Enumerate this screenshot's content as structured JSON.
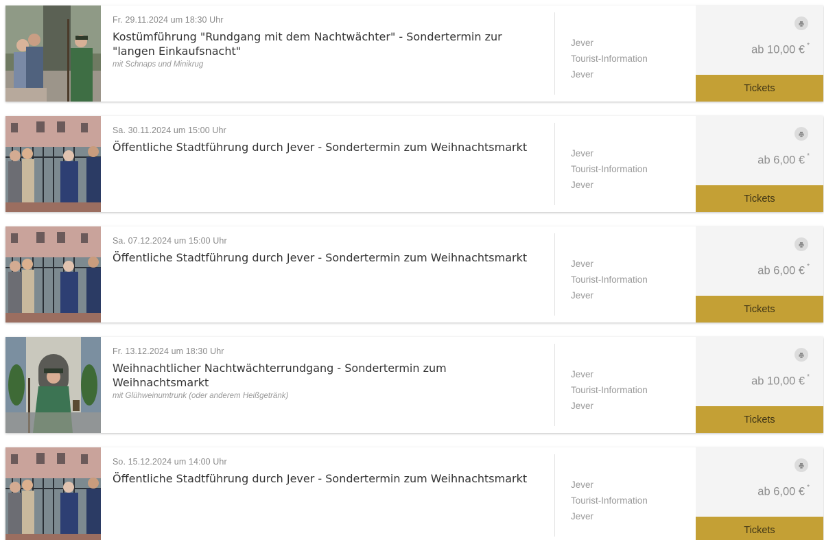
{
  "colors": {
    "tickets_button": "#c4a035",
    "price_panel": "#f4f4f4",
    "date_text": "#8a8a8a",
    "location_text": "#9a9a9a"
  },
  "events": [
    {
      "date": "Fr. 29.11.2024 um 18:30 Uhr",
      "title": "Kostümführung \"Rundgang mit dem Nachtwächter\" - Sondertermin zur \"langen Einkaufsnacht\"",
      "subtitle": "mit Schnaps und Minikrug",
      "location": [
        "Jever",
        "Tourist-Information",
        "Jever"
      ],
      "price": "ab 10,00 €",
      "price_mark": "*",
      "tickets_label": "Tickets",
      "print_icon": "print-icon",
      "image": "night-watchman-group-photo"
    },
    {
      "date": "Sa. 30.11.2024 um 15:00 Uhr",
      "title": "Öffentliche Stadtführung durch Jever - Sondertermin zum Weihnachtsmarkt",
      "subtitle": "",
      "location": [
        "Jever",
        "Tourist-Information",
        "Jever"
      ],
      "price": "ab 6,00 €",
      "price_mark": "*",
      "tickets_label": "Tickets",
      "print_icon": "print-icon",
      "image": "city-tour-group-photo"
    },
    {
      "date": "Sa. 07.12.2024 um 15:00 Uhr",
      "title": "Öffentliche Stadtführung durch Jever - Sondertermin zum Weihnachtsmarkt",
      "subtitle": "",
      "location": [
        "Jever",
        "Tourist-Information",
        "Jever"
      ],
      "price": "ab 6,00 €",
      "price_mark": "*",
      "tickets_label": "Tickets",
      "print_icon": "print-icon",
      "image": "city-tour-group-photo"
    },
    {
      "date": "Fr. 13.12.2024 um 18:30 Uhr",
      "title": "Weihnachtlicher Nachtwächterrundgang - Sondertermin zum Weihnachtsmarkt",
      "subtitle": "mit Glühweinumtrunk (oder anderem Heißgetränk)",
      "location": [
        "Jever",
        "Tourist-Information",
        "Jever"
      ],
      "price": "ab 10,00 €",
      "price_mark": "*",
      "tickets_label": "Tickets",
      "print_icon": "print-icon",
      "image": "night-watchman-lantern-photo"
    },
    {
      "date": "So. 15.12.2024 um 14:00 Uhr",
      "title": "Öffentliche Stadtführung durch Jever - Sondertermin zum Weihnachtsmarkt",
      "subtitle": "",
      "location": [
        "Jever",
        "Tourist-Information",
        "Jever"
      ],
      "price": "ab 6,00 €",
      "price_mark": "*",
      "tickets_label": "Tickets",
      "print_icon": "print-icon",
      "image": "city-tour-group-photo"
    }
  ]
}
